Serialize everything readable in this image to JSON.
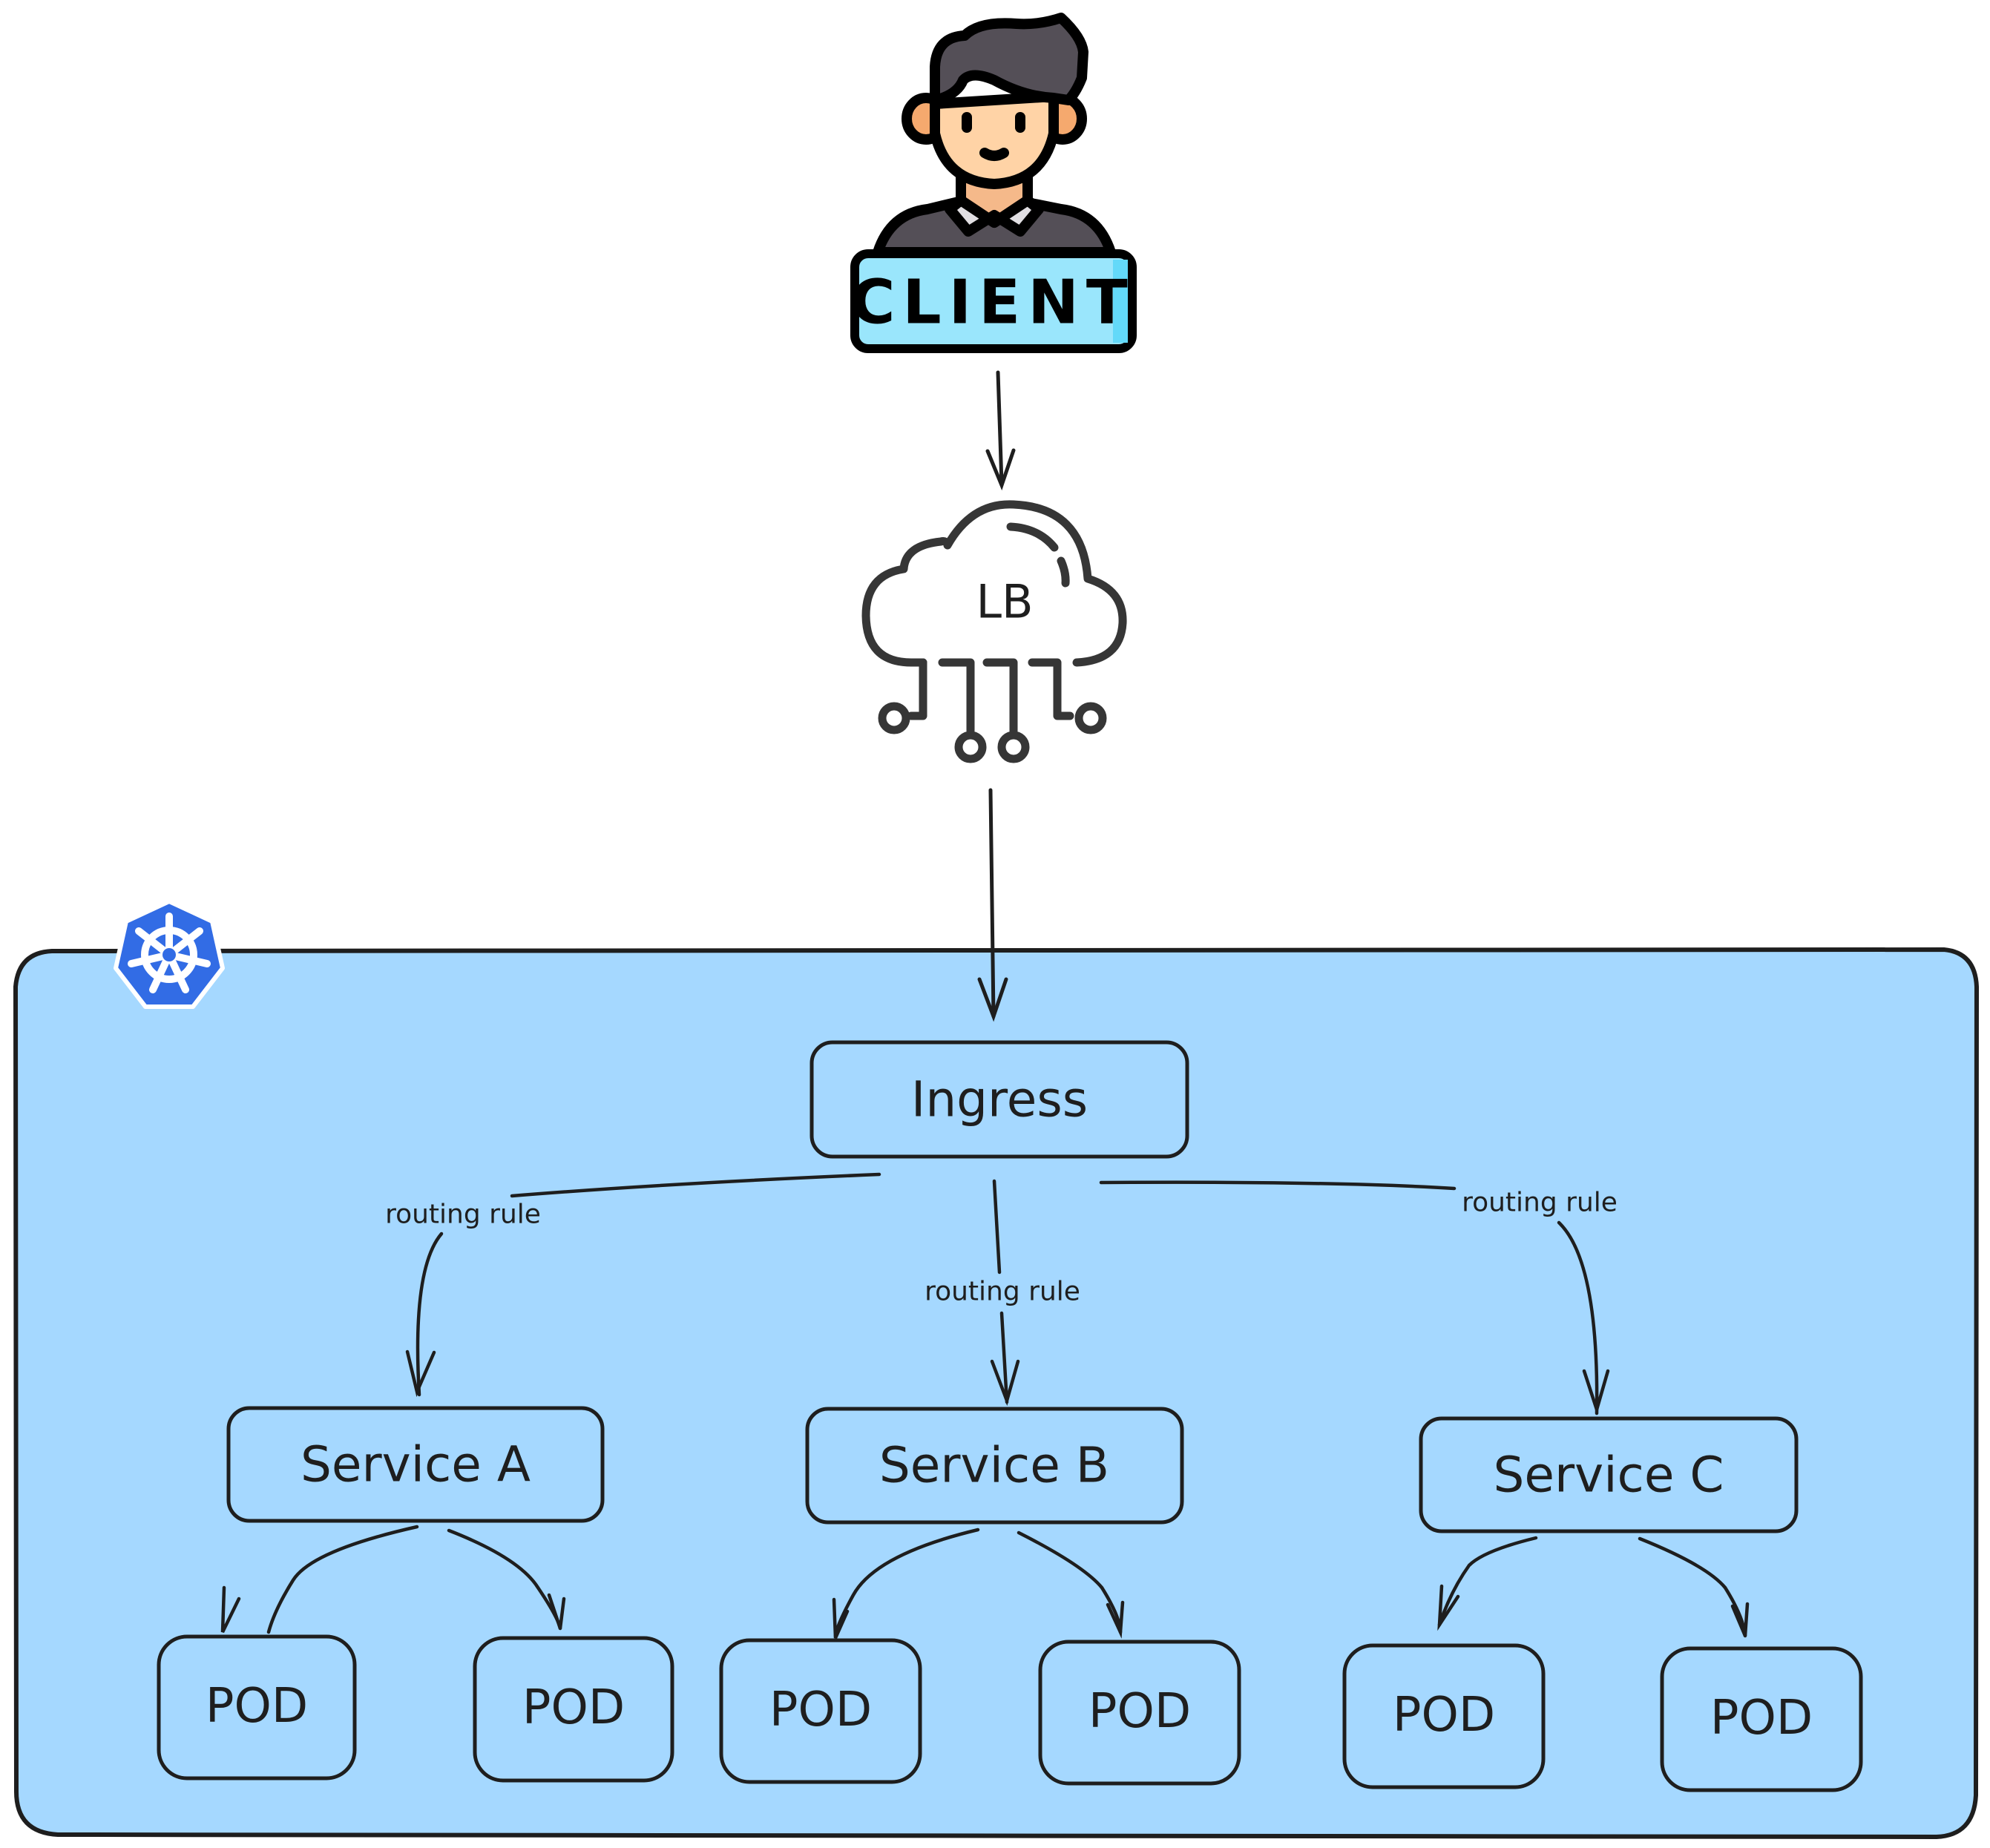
{
  "client": {
    "label": "CLIENT",
    "icon": "person-icon"
  },
  "load_balancer": {
    "label": "LB",
    "icon": "cloud-network-icon"
  },
  "cluster": {
    "icon": "kubernetes-helm-icon",
    "fill_color": "#a5d8ff",
    "logo_color": "#326ce5"
  },
  "ingress": {
    "label": "Ingress"
  },
  "edges": {
    "routing_label_a": "routing rule",
    "routing_label_b": "routing rule",
    "routing_label_c": "routing rule"
  },
  "services": [
    {
      "label": "Service A",
      "pods": [
        "POD",
        "POD"
      ]
    },
    {
      "label": "Service B",
      "pods": [
        "POD",
        "POD"
      ]
    },
    {
      "label": "Service C",
      "pods": [
        "POD",
        "POD"
      ]
    }
  ],
  "colors": {
    "stroke": "#1e1e1e",
    "client_badge": "#9ae6fc",
    "client_badge_shade": "#63d9f9",
    "hair": "#544f57",
    "skin": "#ffd3a6",
    "skin_shade": "#f5a96e",
    "collar": "#e1dfe3"
  }
}
